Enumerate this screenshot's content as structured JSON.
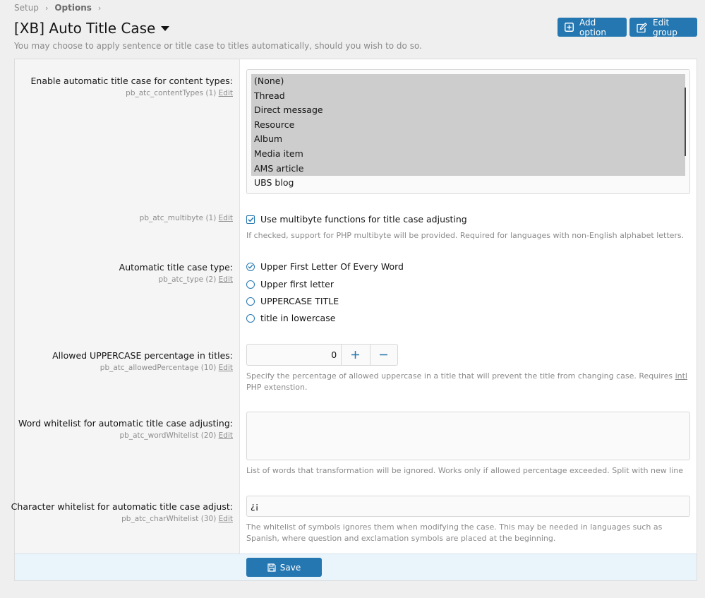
{
  "breadcrumb": {
    "items": [
      "Setup",
      "Options"
    ]
  },
  "page": {
    "title": "[XB] Auto Title Case",
    "description": "You may choose to apply sentence or title case to titles automatically, should you wish to do so."
  },
  "header_buttons": {
    "add_option": "Add option",
    "edit_group": "Edit group"
  },
  "colors": {
    "accent": "#2577b1",
    "footer_bg": "#eaf4fb",
    "selected_option_bg": "#cdcdcd"
  },
  "options": {
    "content_types": {
      "label": "Enable automatic title case for content types:",
      "hint": "pb_atc_contentTypes (1)",
      "edit": "Edit",
      "choices": [
        {
          "label": "(None)",
          "selected": true
        },
        {
          "label": "Thread",
          "selected": true
        },
        {
          "label": "Direct message",
          "selected": true
        },
        {
          "label": "Resource",
          "selected": true
        },
        {
          "label": "Album",
          "selected": true
        },
        {
          "label": "Media item",
          "selected": true
        },
        {
          "label": "AMS article",
          "selected": true
        },
        {
          "label": "UBS blog",
          "selected": false
        }
      ]
    },
    "multibyte": {
      "hint": "pb_atc_multibyte (1)",
      "edit": "Edit",
      "checkbox_label": "Use multibyte functions for title case adjusting",
      "checked": true,
      "explain": "If checked, support for PHP multibyte will be provided. Required for languages with non-English alphabet letters."
    },
    "type": {
      "label": "Automatic title case type:",
      "hint": "pb_atc_type (2)",
      "edit": "Edit",
      "choices": [
        {
          "label": "Upper First Letter Of Every Word",
          "checked": true
        },
        {
          "label": "Upper first letter",
          "checked": false
        },
        {
          "label": "UPPERCASE TITLE",
          "checked": false
        },
        {
          "label": "title in lowercase",
          "checked": false
        }
      ]
    },
    "allowed_percentage": {
      "label": "Allowed UPPERCASE percentage in titles:",
      "hint": "pb_atc_allowedPercentage (10)",
      "edit": "Edit",
      "value": "0",
      "explain_before": "Specify the percentage of allowed uppercase in a title that will prevent the title from changing case. Requires ",
      "explain_abbr": "intl",
      "explain_after": " PHP extenstion."
    },
    "word_whitelist": {
      "label": "Word whitelist for automatic title case adjusting:",
      "hint": "pb_atc_wordWhitelist (20)",
      "edit": "Edit",
      "value": "",
      "explain": "List of words that transformation will be ignored. Works only if allowed percentage exceeded. Split with new line"
    },
    "char_whitelist": {
      "label": "Character whitelist for automatic title case adjust:",
      "hint": "pb_atc_charWhitelist (30)",
      "edit": "Edit",
      "value": "¿¡",
      "explain": "The whitelist of symbols ignores them when modifying the case. This may be needed in languages such as Spanish, where question and exclamation symbols are placed at the beginning."
    }
  },
  "footer": {
    "save_label": "Save"
  }
}
